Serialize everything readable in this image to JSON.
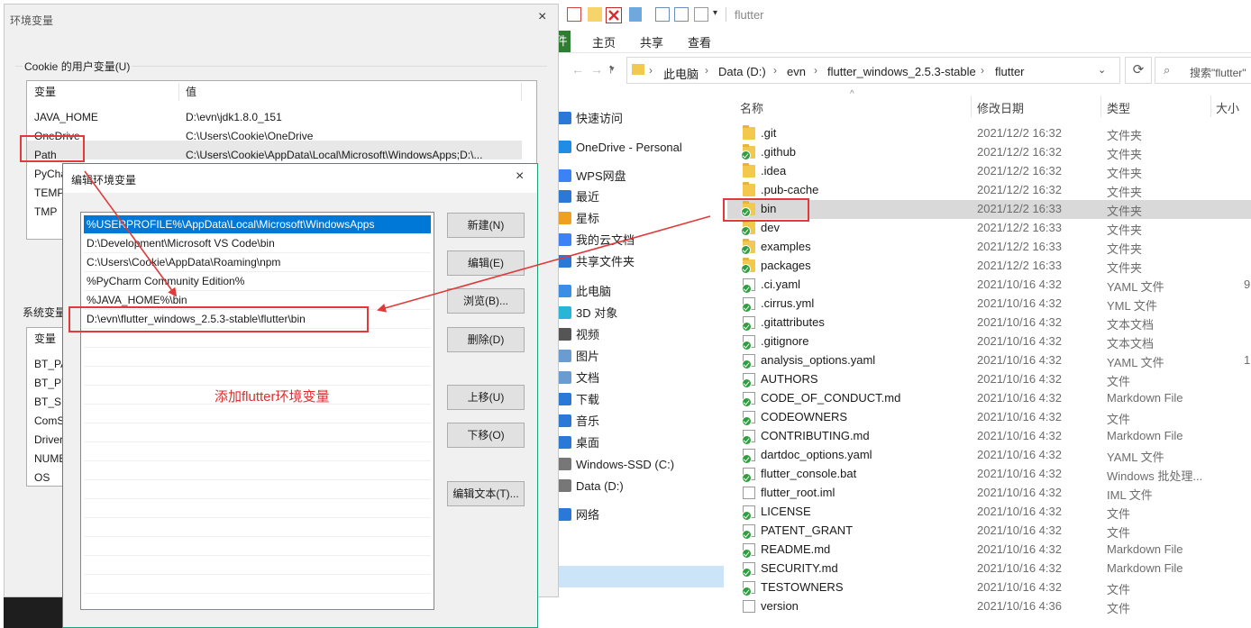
{
  "env_window": {
    "title": "环境变量",
    "close": "×",
    "user_group_label": "Cookie 的用户变量(U)",
    "col_var": "变量",
    "col_val": "值",
    "user_vars": [
      {
        "name": "JAVA_HOME",
        "value": "D:\\evn\\jdk1.8.0_151"
      },
      {
        "name": "OneDrive",
        "value": "C:\\Users\\Cookie\\OneDrive"
      },
      {
        "name": "Path",
        "value": "C:\\Users\\Cookie\\AppData\\Local\\Microsoft\\WindowsApps;D:\\..."
      },
      {
        "name": "PyCha",
        "value": ""
      },
      {
        "name": "TEMP",
        "value": ""
      },
      {
        "name": "TMP",
        "value": ""
      }
    ],
    "system_group_label": "系统变量",
    "system_vars": [
      "BT_PA",
      "BT_PY",
      "BT_SE",
      "ComS",
      "Driver",
      "NUME",
      "OS"
    ]
  },
  "edit_dialog": {
    "title": "编辑环境变量",
    "close": "×",
    "paths": [
      "%USERPROFILE%\\AppData\\Local\\Microsoft\\WindowsApps",
      "D:\\Development\\Microsoft VS Code\\bin",
      "C:\\Users\\Cookie\\AppData\\Roaming\\npm",
      "%PyCharm Community Edition%",
      "%JAVA_HOME%\\bin",
      "D:\\evn\\flutter_windows_2.5.3-stable\\flutter\\bin"
    ],
    "buttons": {
      "new": "新建(N)",
      "edit": "编辑(E)",
      "browse": "浏览(B)...",
      "delete": "删除(D)",
      "move_up": "上移(U)",
      "move_down": "下移(O)",
      "edit_text": "编辑文本(T)..."
    },
    "annotation": "添加flutter环境变量"
  },
  "explorer": {
    "title": "flutter",
    "ribbon_tabs": [
      "件",
      "主页",
      "共享",
      "查看"
    ],
    "breadcrumb": [
      "此电脑",
      "Data (D:)",
      "evn",
      "flutter_windows_2.5.3-stable",
      "flutter"
    ],
    "search_placeholder": "搜索\"flutter\"",
    "nav_items": [
      {
        "label": "快速访问",
        "color": "#2b79d6"
      },
      {
        "label": "OneDrive - Personal",
        "color": "#1f8ce6"
      },
      {
        "label": "WPS网盘",
        "color": "#3b82f6"
      },
      {
        "label": "最近",
        "color": "#2b79d6"
      },
      {
        "label": "星标",
        "color": "#f0a020"
      },
      {
        "label": "我的云文档",
        "color": "#3b82f6"
      },
      {
        "label": "共享文件夹",
        "color": "#2b79d6"
      },
      {
        "label": "此电脑",
        "color": "#3a8ee6"
      },
      {
        "label": "3D 对象",
        "color": "#29b6d6"
      },
      {
        "label": "视频",
        "color": "#555555"
      },
      {
        "label": "图片",
        "color": "#6a9bd1"
      },
      {
        "label": "文档",
        "color": "#6a9bd1"
      },
      {
        "label": "下载",
        "color": "#2b79d6"
      },
      {
        "label": "音乐",
        "color": "#2b79d6"
      },
      {
        "label": "桌面",
        "color": "#2b79d6"
      },
      {
        "label": "Windows-SSD (C:)",
        "color": "#777777"
      },
      {
        "label": "Data (D:)",
        "color": "#777777"
      },
      {
        "label": "网络",
        "color": "#2b79d6"
      }
    ],
    "columns": {
      "name": "名称",
      "date": "修改日期",
      "type": "类型",
      "size": "大小"
    },
    "files": [
      {
        "name": ".git",
        "date": "2021/12/2 16:32",
        "type": "文件夹",
        "size": "",
        "kind": "folder",
        "git": false
      },
      {
        "name": ".github",
        "date": "2021/12/2 16:32",
        "type": "文件夹",
        "size": "",
        "kind": "folder",
        "git": true
      },
      {
        "name": ".idea",
        "date": "2021/12/2 16:32",
        "type": "文件夹",
        "size": "",
        "kind": "folder",
        "git": false
      },
      {
        "name": ".pub-cache",
        "date": "2021/12/2 16:32",
        "type": "文件夹",
        "size": "",
        "kind": "folder",
        "git": false
      },
      {
        "name": "bin",
        "date": "2021/12/2 16:33",
        "type": "文件夹",
        "size": "",
        "kind": "folder",
        "git": true
      },
      {
        "name": "dev",
        "date": "2021/12/2 16:33",
        "type": "文件夹",
        "size": "",
        "kind": "folder",
        "git": true
      },
      {
        "name": "examples",
        "date": "2021/12/2 16:33",
        "type": "文件夹",
        "size": "",
        "kind": "folder",
        "git": true
      },
      {
        "name": "packages",
        "date": "2021/12/2 16:33",
        "type": "文件夹",
        "size": "",
        "kind": "folder",
        "git": true
      },
      {
        "name": ".ci.yaml",
        "date": "2021/10/16 4:32",
        "type": "YAML 文件",
        "size": "9",
        "kind": "file",
        "git": true
      },
      {
        "name": ".cirrus.yml",
        "date": "2021/10/16 4:32",
        "type": "YML 文件",
        "size": "",
        "kind": "file",
        "git": true
      },
      {
        "name": ".gitattributes",
        "date": "2021/10/16 4:32",
        "type": "文本文档",
        "size": "",
        "kind": "file",
        "git": true
      },
      {
        "name": ".gitignore",
        "date": "2021/10/16 4:32",
        "type": "文本文档",
        "size": "",
        "kind": "file",
        "git": true
      },
      {
        "name": "analysis_options.yaml",
        "date": "2021/10/16 4:32",
        "type": "YAML 文件",
        "size": "1",
        "kind": "file",
        "git": true
      },
      {
        "name": "AUTHORS",
        "date": "2021/10/16 4:32",
        "type": "文件",
        "size": "",
        "kind": "file",
        "git": true
      },
      {
        "name": "CODE_OF_CONDUCT.md",
        "date": "2021/10/16 4:32",
        "type": "Markdown File",
        "size": "",
        "kind": "file",
        "git": true
      },
      {
        "name": "CODEOWNERS",
        "date": "2021/10/16 4:32",
        "type": "文件",
        "size": "",
        "kind": "file",
        "git": true
      },
      {
        "name": "CONTRIBUTING.md",
        "date": "2021/10/16 4:32",
        "type": "Markdown File",
        "size": "",
        "kind": "file",
        "git": true
      },
      {
        "name": "dartdoc_options.yaml",
        "date": "2021/10/16 4:32",
        "type": "YAML 文件",
        "size": "",
        "kind": "file",
        "git": true
      },
      {
        "name": "flutter_console.bat",
        "date": "2021/10/16 4:32",
        "type": "Windows 批处理...",
        "size": "",
        "kind": "file",
        "git": true
      },
      {
        "name": "flutter_root.iml",
        "date": "2021/10/16 4:32",
        "type": "IML 文件",
        "size": "",
        "kind": "file",
        "git": false
      },
      {
        "name": "LICENSE",
        "date": "2021/10/16 4:32",
        "type": "文件",
        "size": "",
        "kind": "file",
        "git": true
      },
      {
        "name": "PATENT_GRANT",
        "date": "2021/10/16 4:32",
        "type": "文件",
        "size": "",
        "kind": "file",
        "git": true
      },
      {
        "name": "README.md",
        "date": "2021/10/16 4:32",
        "type": "Markdown File",
        "size": "",
        "kind": "file",
        "git": true
      },
      {
        "name": "SECURITY.md",
        "date": "2021/10/16 4:32",
        "type": "Markdown File",
        "size": "",
        "kind": "file",
        "git": true
      },
      {
        "name": "TESTOWNERS",
        "date": "2021/10/16 4:32",
        "type": "文件",
        "size": "",
        "kind": "file",
        "git": true
      },
      {
        "name": "version",
        "date": "2021/10/16 4:36",
        "type": "文件",
        "size": "",
        "kind": "file",
        "git": false
      }
    ]
  },
  "colors": {
    "accent": "#0078d7",
    "annotation_red": "#e02d2d",
    "ribbon_green": "#2e7d32"
  }
}
